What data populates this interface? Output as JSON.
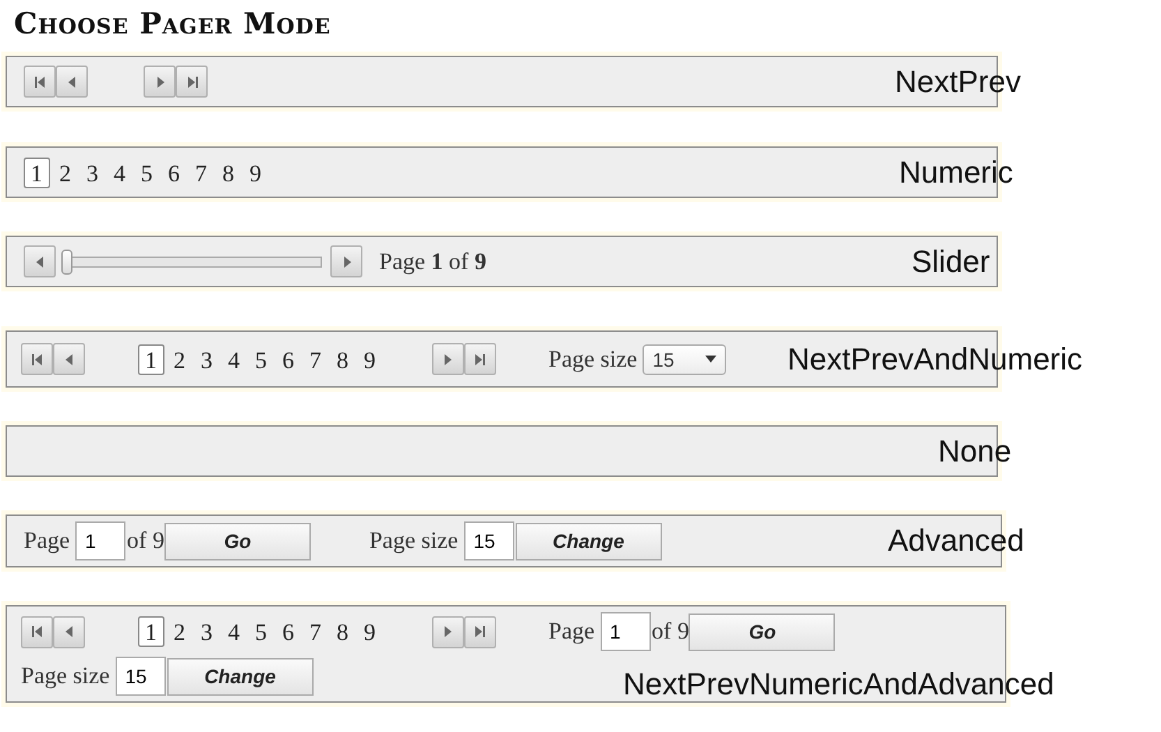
{
  "title": "Choose Pager Mode",
  "pagers": [
    {
      "kind": "nextprev",
      "label": "NextPrev"
    },
    {
      "kind": "numeric",
      "label": "Numeric",
      "pages": [
        {
          "text": "1",
          "selected": true
        },
        {
          "text": "2",
          "selected": false
        },
        {
          "text": "3",
          "selected": false
        },
        {
          "text": "4",
          "selected": false
        },
        {
          "text": "5",
          "selected": false
        },
        {
          "text": "6",
          "selected": false
        },
        {
          "text": "7",
          "selected": false
        },
        {
          "text": "8",
          "selected": false
        },
        {
          "text": "9",
          "selected": false
        }
      ]
    },
    {
      "kind": "slider",
      "label": "Slider",
      "level": 0,
      "status": "Page **1** of **9**"
    },
    {
      "kind": "nextprev_numeric",
      "label": "NextPrevAndNumeric",
      "pages": [
        {
          "text": "1",
          "selected": true
        },
        {
          "text": "2",
          "selected": false
        },
        {
          "text": "3",
          "selected": false
        },
        {
          "text": "4",
          "selected": false
        },
        {
          "text": "5",
          "selected": false
        },
        {
          "text": "6",
          "selected": false
        },
        {
          "text": "7",
          "selected": false
        },
        {
          "text": "8",
          "selected": false
        },
        {
          "text": "9",
          "selected": false
        }
      ],
      "page_size_label": "Page size",
      "page_size": "15"
    },
    {
      "kind": "none",
      "label": "None"
    },
    {
      "kind": "advanced",
      "label": "Advanced",
      "page_label": "Page",
      "page": "1",
      "of_text": "of 9",
      "go": "Go",
      "page_size_label": "Page size",
      "page_size": "15",
      "change": "Change"
    },
    {
      "kind": "nextprev_numeric_advanced",
      "label": "NextPrevNumericAndAdvanced",
      "pages": [
        {
          "text": "1",
          "selected": true
        },
        {
          "text": "2",
          "selected": false
        },
        {
          "text": "3",
          "selected": false
        },
        {
          "text": "4",
          "selected": false
        },
        {
          "text": "5",
          "selected": false
        },
        {
          "text": "6",
          "selected": false
        },
        {
          "text": "7",
          "selected": false
        },
        {
          "text": "8",
          "selected": false
        },
        {
          "text": "9",
          "selected": false
        }
      ],
      "page_label": "Page",
      "page": "1",
      "of_text": "of 9",
      "go": "Go",
      "page_size_label": "Page size",
      "page_size": "15",
      "change": "Change"
    }
  ]
}
